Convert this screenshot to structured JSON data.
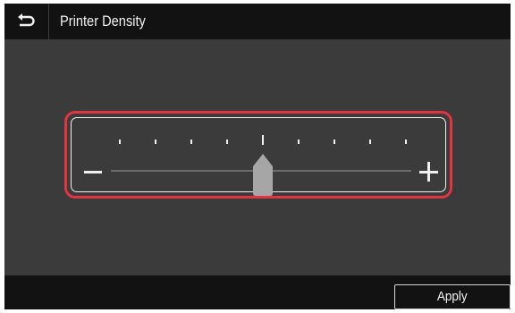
{
  "header": {
    "back_icon": "back-arrow-icon",
    "title": "Printer Density"
  },
  "density_slider": {
    "min_icon": "minus-icon",
    "max_icon": "plus-icon",
    "tick_count": 9,
    "current_step": 5,
    "current_fraction": 0.5,
    "highlight_color": "#e3353f"
  },
  "footer": {
    "apply_label": "Apply"
  },
  "colors": {
    "background": "#3b3b3b",
    "bar": "#121212",
    "foreground": "#f0f0f0"
  }
}
